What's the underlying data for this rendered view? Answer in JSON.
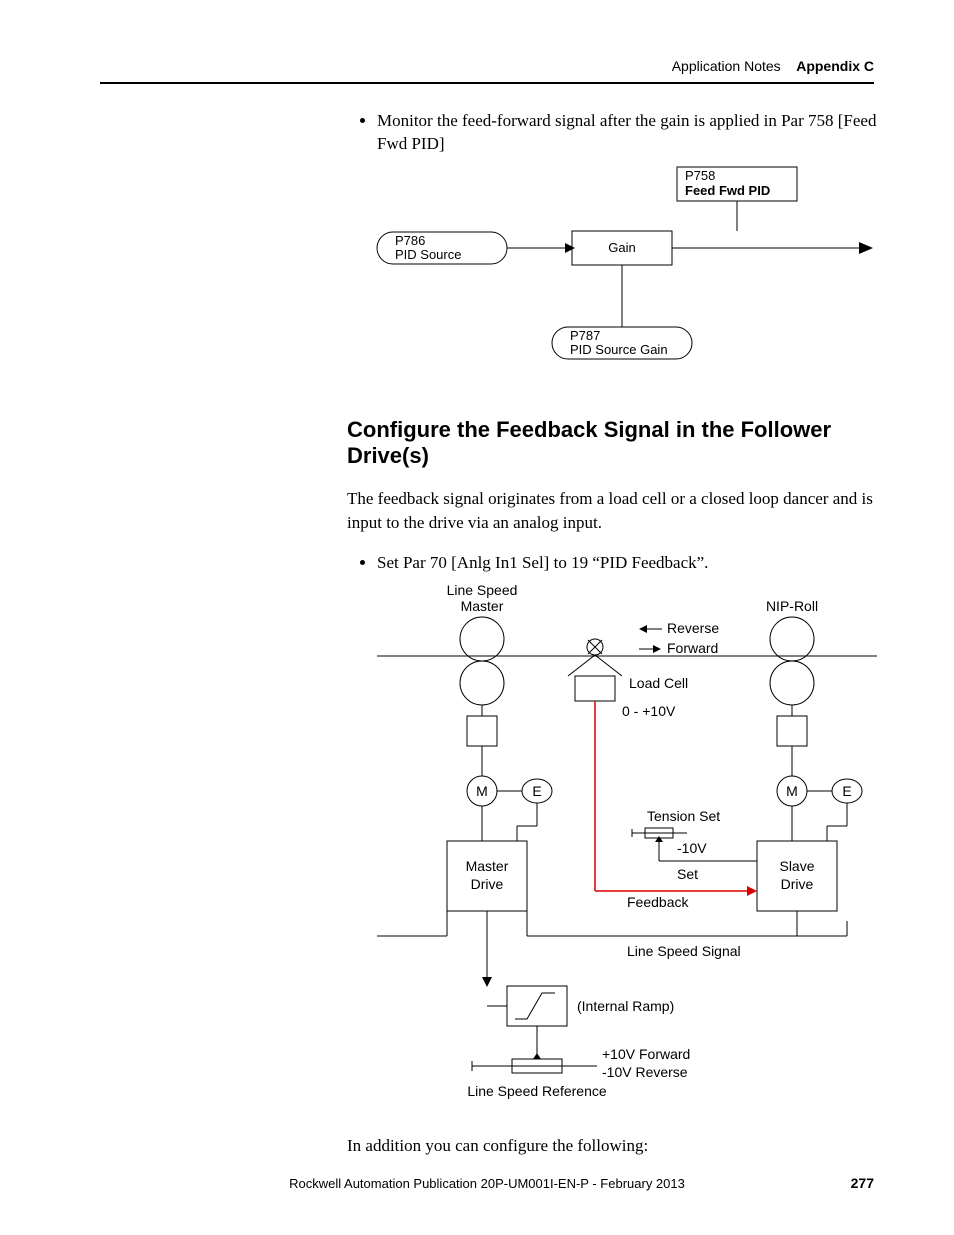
{
  "header": {
    "left": "Application Notes",
    "right": "Appendix C"
  },
  "bullet1": "Monitor the feed-forward signal after the gain is applied in Par 758 [Feed Fwd PID]",
  "diagram1": {
    "p758a": "P758",
    "p758b": "Feed Fwd PID",
    "p786a": "P786",
    "p786b": "PID Source",
    "gain": "Gain",
    "p787a": "P787",
    "p787b": "PID Source Gain"
  },
  "sectionTitle": "Configure the Feedback Signal in the Follower Drive(s)",
  "para1": "The feedback signal originates from a load cell or a closed loop dancer and is input to the drive via an analog input.",
  "bullet2": "Set Par 70 [Anlg In1 Sel] to 19 “PID Feedback”.",
  "diagram2": {
    "lineSpeed1": "Line Speed",
    "lineSpeed2": "Master",
    "nipRoll": "NIP-Roll",
    "reverse": "Reverse",
    "forward": "Forward",
    "loadCell": "Load Cell",
    "loadCellV": "0 - +10V",
    "m": "M",
    "e": "E",
    "tensionSet": "Tension Set",
    "tensionV": "-10V",
    "set": "Set",
    "feedback": "Feedback",
    "masterDrive1": "Master",
    "masterDrive2": "Drive",
    "slaveDrive1": "Slave",
    "slaveDrive2": "Drive",
    "lineSpeedSignal": "Line Speed Signal",
    "internalRamp": "(Internal Ramp)",
    "vFwd": "+10V Forward",
    "vRev": "-10V Reverse",
    "lineSpeedRef": "Line Speed Reference"
  },
  "para2": "In addition you can configure the following:",
  "footer": "Rockwell Automation Publication 20P-UM001I-EN-P - February 2013",
  "pageNumber": "277"
}
